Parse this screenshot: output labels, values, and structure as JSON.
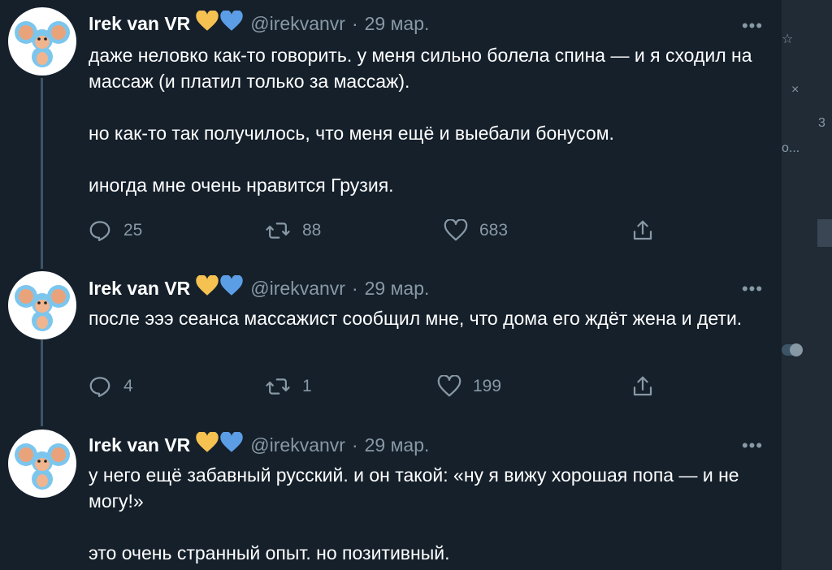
{
  "tweets": [
    {
      "author": {
        "name": "Irek van VR",
        "handle": "@irekvanvr",
        "badges": [
          "yellow-heart-icon",
          "blue-heart-icon"
        ]
      },
      "separator": "·",
      "date": "29 мар.",
      "more": "•••",
      "paragraphs": [
        "даже неловко как-то говорить. у меня сильно болела спина — и я сходил на массаж (и платил только за массаж).",
        "но как-то так получилось, что меня ещё и выебали бонусом.",
        "иногда мне очень нравится Грузия."
      ],
      "replies": "25",
      "retweets": "88",
      "likes": "683"
    },
    {
      "author": {
        "name": "Irek van VR",
        "handle": "@irekvanvr",
        "badges": [
          "yellow-heart-icon",
          "blue-heart-icon"
        ]
      },
      "separator": "·",
      "date": "29 мар.",
      "more": "•••",
      "paragraphs": [
        "после эээ сеанса массажист сообщил мне, что дома его ждёт жена и дети."
      ],
      "replies": "4",
      "retweets": "1",
      "likes": "199"
    },
    {
      "author": {
        "name": "Irek van VR",
        "handle": "@irekvanvr",
        "badges": [
          "yellow-heart-icon",
          "blue-heart-icon"
        ]
      },
      "separator": "·",
      "date": "29 мар.",
      "more": "•••",
      "paragraphs": [
        "у него ещё забавный русский. и он такой: «ну я вижу хорошая попа — и не могу!»",
        "это очень странный опыт. но позитивный."
      ]
    }
  ],
  "side_panel": {
    "fragments": [
      "3",
      "o..."
    ]
  },
  "colors": {
    "background": "#15202b",
    "secondary_text": "#8899a6",
    "thread_line": "#3d5466",
    "yellow_heart": "#f5c151",
    "blue_heart": "#5c9ee6"
  }
}
